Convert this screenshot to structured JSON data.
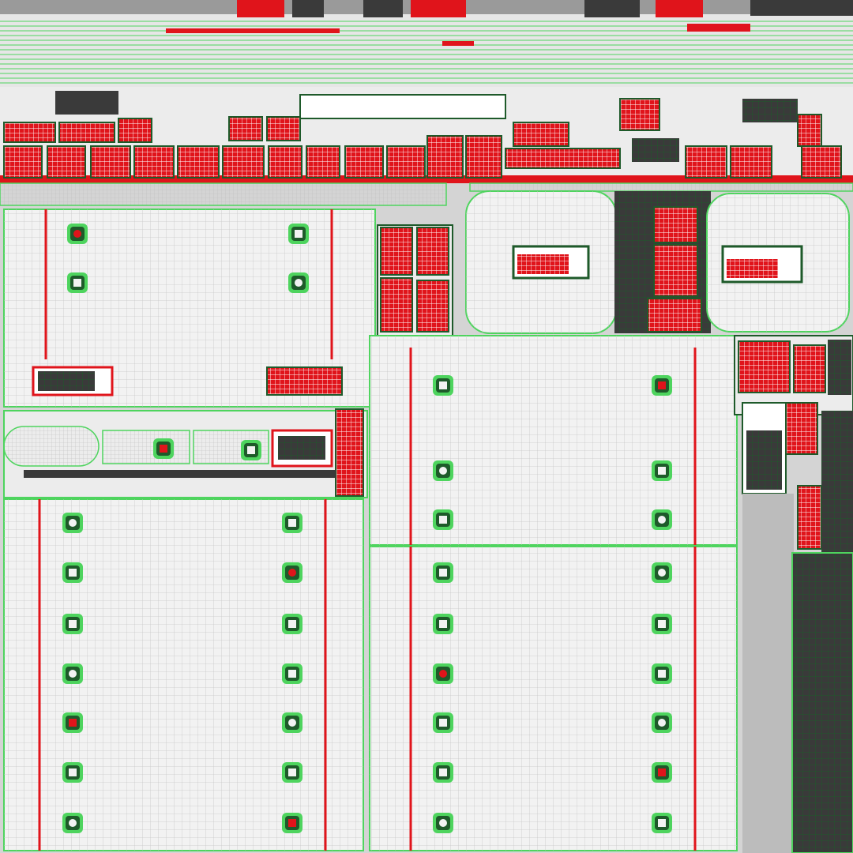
{
  "view": {
    "kind": "uv-texture-layout",
    "printed_text": []
  },
  "colors": {
    "background": "#d4d4d4",
    "island_fill": "#f2f2f2",
    "wire_light": "#c8c8c8",
    "seam_green": "#4ed45e",
    "outline_dark_green": "#1e5a2a",
    "flip_red": "#e0141b",
    "dark_panel": "#3a3a3a",
    "mid_gray": "#9a9a9a"
  },
  "regions": {
    "top_strip": "dense-mechanical-parts",
    "upper_left_panel": "large-seat-panel",
    "center_panel": "large-seat-panel",
    "right_double_panel": "console-panels",
    "lower_left_panel": "large-seat-panel",
    "lower_center_panel": "large-seat-panel",
    "right_column": "mechanical-strip"
  },
  "icons": {
    "fastener": "square-bolt-icon",
    "knob": "round-knob-icon"
  }
}
